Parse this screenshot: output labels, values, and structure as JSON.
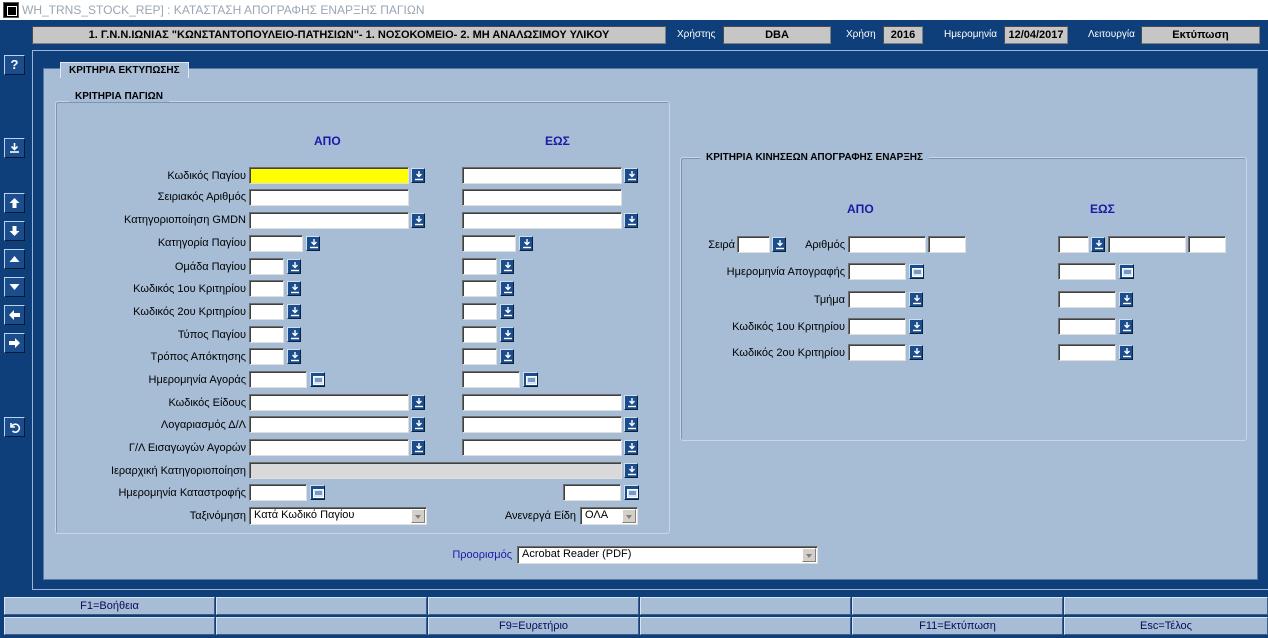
{
  "window": {
    "title": "WH_TRNS_STOCK_REP]  :  ΚΑΤΑΣΤΑΣΗ ΑΠΟΓΡΑΦΗΣ ΕΝΑΡΞΗΣ ΠΑΓΙΩΝ"
  },
  "header": {
    "organization": "1. Γ.Ν.Ν.ΙΩΝΙΑΣ \"ΚΩΝΣΤΑΝΤΟΠΟΥΛΕΙΟ-ΠΑΤΗΣΙΩΝ\"- 1. ΝΟΣΟΚΟΜΕΙΟ- 2. ΜΗ ΑΝΑΛΩΣΙΜΟΥ ΥΛΙΚΟΥ",
    "user_label": "Χρήστης",
    "user_value": "DBA",
    "year_label": "Χρήση",
    "year_value": "2016",
    "date_label": "Ημερομηνία",
    "date_value": "12/04/2017",
    "function_label": "Λειτουργία",
    "function_value": "Εκτύπωση"
  },
  "side_toolbar": {
    "help_label": "?"
  },
  "tab_title": "ΚΡΙΤΗΡΙΑ ΕΚΤΥΠΩΣΗΣ",
  "assets_group": {
    "title": "ΚΡΙΤΗΡΙΑ ΠΑΓΙΩΝ",
    "from_header": "ΑΠΟ",
    "to_header": "ΕΩΣ",
    "labels": {
      "asset_code": "Κωδικός Παγίου",
      "serial_number": "Σειριακός Αριθμός",
      "gmdn": "Κατηγοριοποίηση GMDN",
      "asset_category": "Κατηγορία Παγίου",
      "asset_group": "Ομάδα Παγίου",
      "criterion1": "Κωδικός 1ου Κριτηρίου",
      "criterion2": "Κωδικός 2ου Κριτηρίου",
      "asset_type": "Τύπος Παγίου",
      "acquisition_method": "Τρόπος Απόκτησης",
      "purchase_date": "Ημερομηνία Αγοράς",
      "item_code": "Κωδικός Είδους",
      "account": "Λογαριασμός Δ/Λ",
      "gl_imports": "Γ/Λ Εισαγωγών Αγορών",
      "hierarchy": "Ιεραρχική Κατηγοριοποίηση",
      "destruction_date": "Ημερομηνία Καταστροφής",
      "sort": "Ταξινόμηση",
      "inactive": "Ανενεργά Είδη"
    },
    "sort_value": "Κατά Κωδικό Παγίου",
    "inactive_value": "ΟΛΑ"
  },
  "movements_group": {
    "title": "ΚΡΙΤΗΡΙΑ ΚΙΝΗΣΕΩΝ ΑΠΟΓΡΑΦΗΣ ΕΝΑΡΞΗΣ",
    "from_header": "ΑΠΟ",
    "to_header": "ΕΩΣ",
    "labels": {
      "series": "Σειρά",
      "number": "Αριθμός",
      "inventory_date": "Ημερομηνία Απογραφής",
      "department": "Τμήμα",
      "criterion1": "Κωδικός 1ου Κριτηρίου",
      "criterion2": "Κωδικός 2ου Κριτηρίου"
    }
  },
  "destination": {
    "label": "Προορισμός",
    "value": "Acrobat Reader (PDF)"
  },
  "function_keys": {
    "row1": [
      "F1=Βοήθεια",
      "",
      "",
      "",
      "",
      ""
    ],
    "row2": [
      "",
      "",
      "F9=Ευρετήριο",
      "",
      "F11=Εκτύπωση",
      "Esc=Τέλος"
    ]
  },
  "colors": {
    "background": "#0f3f7a",
    "panel": "#a7bdd6",
    "focus": "#ffff00",
    "header_text": "#1a1aa6"
  }
}
